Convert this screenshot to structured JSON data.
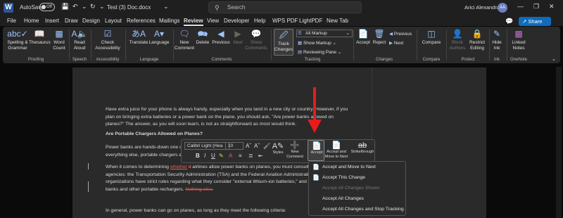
{
  "titlebar": {
    "app_icon": "W",
    "autosave": "AutoSave",
    "toggle": "Off",
    "doc_title": "Test (3) Doc.docx",
    "search": "Search",
    "user": "Arici Alexandra",
    "avatar": "AA"
  },
  "menu": {
    "tabs": [
      "File",
      "Home",
      "Insert",
      "Draw",
      "Design",
      "Layout",
      "References",
      "Mailings",
      "Review",
      "View",
      "Developer",
      "Help",
      "WPS PDF",
      "LightPDF",
      "New Tab"
    ],
    "active": "Review",
    "share": "Share"
  },
  "ribbon": {
    "spelling": "Spelling &\nGrammar",
    "thesaurus": "Thesaurus",
    "wordcount": "Word\nCount",
    "readaloud": "Read\nAloud",
    "checkaccess": "Check\nAccessibility",
    "translate": "Translate",
    "language": "Language",
    "newcomment": "New\nComment",
    "delete": "Delete",
    "previous": "Previous",
    "next": "Next",
    "showcomments": "Show\nComments",
    "trackchanges": "Track\nChanges",
    "allmarkup": "All Markup",
    "showmarkup": "Show Markup",
    "reviewingpane": "Reviewing Pane",
    "accept": "Accept",
    "reject": "Reject",
    "prevchange": "Previous",
    "nextchange": "Next",
    "compare": "Compare",
    "blockauthors": "Block\nAuthors",
    "restrictediting": "Restrict\nEditing",
    "hideink": "Hide\nInk",
    "linkednotes": "Linked\nNotes",
    "groups": {
      "proofing": "Proofing",
      "speech": "Speech",
      "accessibility": "Accessibility",
      "language": "Language",
      "comments": "Comments",
      "tracking": "Tracking",
      "changes": "Changes",
      "compare": "Compare",
      "protect": "Protect",
      "ink": "Ink",
      "onenote": "OneNote"
    }
  },
  "document": {
    "p1": [
      "Have extra juice for your phone is always handy, especially when you land in a new city or country. However, if you",
      "plan on bringing extra batteries or a power bank on the plane, you should ask, \"Are power banks allowed on",
      "planes?\" The answer, as you will soon learn, is not as straightforward as most would think."
    ],
    "heading": "Are Portable Chargers Allowed on Planes?",
    "p2": [
      "Power banks are hands-down one of t",
      "everything else, portable chargers are a"
    ],
    "p3_start": "When it comes to determining ",
    "p3_ins": "whether",
    "p3_del": "if",
    "p3_rest": " airlines allow power banks on planes, you must consult two g",
    "p3_lines": [
      "agencies: the Transportation Security Administration (TSA) and the Federal Aviation Administration (FA",
      "organizations have strict rules regarding what they consider \"external lithium-ion batteries,\" and this in"
    ],
    "p3_last": "banks and other portable rechargers. ",
    "p3_last_del": "Nothing else.",
    "p4": "In general, power banks can go on planes, as long as they meet the following criteria:"
  },
  "minitoolbar": {
    "font": "Calibri Light (Hea",
    "size": "10",
    "styles": "Styles",
    "newcomment": "New\nComment",
    "accept": "Accept",
    "acceptmove": "Accept and\nMove to Next",
    "strikethrough": "Strikethrough"
  },
  "dropdown": {
    "items": [
      "Accept and Move to Next",
      "Accept This Change",
      "Accept All Changes Shown",
      "Accept All Changes",
      "Accept All Changes and Stop Tracking"
    ]
  },
  "colors": {
    "accent": "#0f6cbd",
    "arrow": "#e81b1b",
    "tracked": "#e25c5c"
  }
}
